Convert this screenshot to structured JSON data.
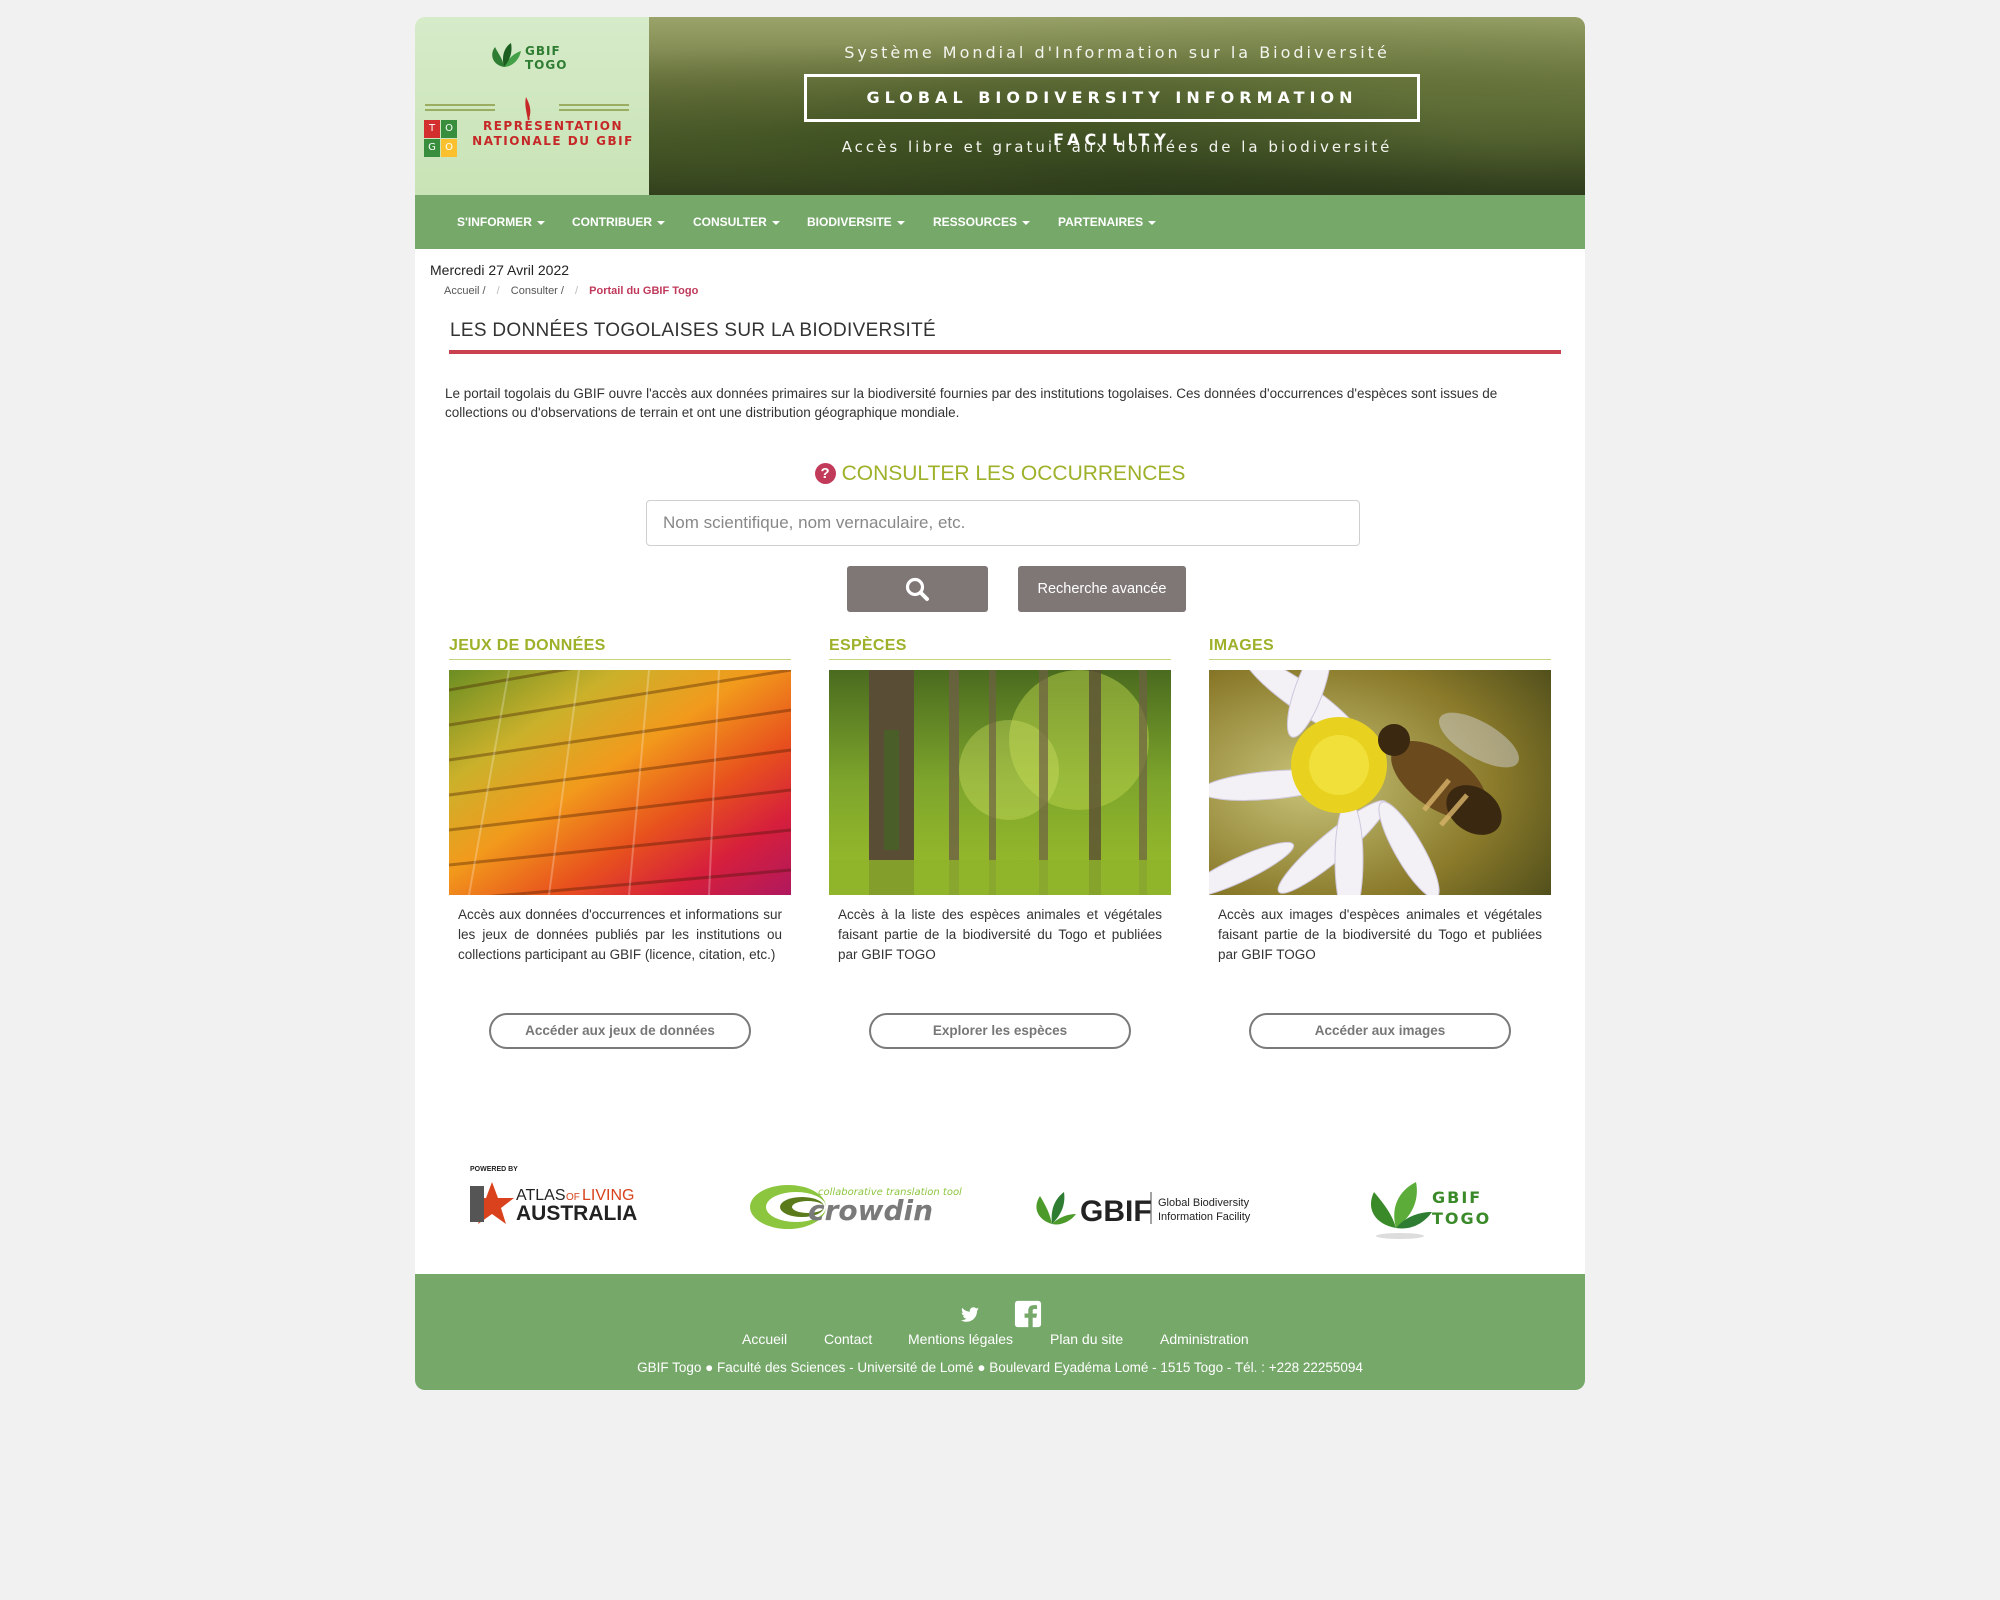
{
  "header": {
    "logo_small_line1": "GBIF",
    "logo_small_line2": "TOGO",
    "rep_line1": "REPRÉSENTATION",
    "rep_line2": "NATIONALE DU GBIF",
    "togo_letters": [
      "T",
      "O",
      "G",
      "O"
    ],
    "banner_top": "Système Mondial d'Information sur la Biodiversité",
    "banner_box": "GLOBAL BIODIVERSITY INFORMATION FACILITY",
    "banner_sub": "Accès libre et gratuit aux données de la biodiversité"
  },
  "nav": {
    "items": [
      "S'INFORMER",
      "CONTRIBUER",
      "CONSULTER",
      "BIODIVERSITE",
      "RESSOURCES",
      "PARTENAIRES"
    ]
  },
  "date": "Mercredi 27 Avril 2022",
  "breadcrumb": {
    "items": [
      "Accueil /",
      "Consulter /",
      "Portail du GBIF Togo"
    ]
  },
  "page_title": "LES DONNÉES TOGOLAISES SUR LA BIODIVERSITÉ",
  "intro": "Le portail togolais du GBIF ouvre l'accès aux données primaires sur la biodiversité fournies par des institutions togolaises. Ces données d'occurrences d'espèces sont issues de collections ou d'observations de terrain et ont une distribution géographique mondiale.",
  "consult": {
    "icon": "?",
    "title": "CONSULTER LES OCCURRENCES",
    "placeholder": "Nom scientifique, nom vernaculaire, etc.",
    "advanced_label": "Recherche avancée"
  },
  "columns": [
    {
      "title": "JEUX DE DONNÉES",
      "text": "Accès aux données d'occurrences et informations sur les jeux de données publiés par les institutions ou collections participant au GBIF (licence, citation, etc.)",
      "button": "Accéder aux jeux de données"
    },
    {
      "title": "ESPÈCES",
      "text": "Accès à la liste des espèces animales et végétales faisant partie de la biodiversité du Togo et publiées par GBIF TOGO",
      "button": "Explorer les espèces"
    },
    {
      "title": "IMAGES",
      "text": "Accès aux images d'espèces animales et végétales faisant partie de la biodiversité du Togo et publiées par GBIF TOGO",
      "button": "Accéder aux images"
    }
  ],
  "partners": {
    "ala_powered": "POWERED BY",
    "ala_name1": "ATLAS",
    "ala_of": "OF",
    "ala_living": "LIVING",
    "ala_name2": "AUSTRALIA",
    "crowdin_tag": "collaborative translation tool",
    "crowdin_name": "crowdin",
    "gbif_name": "GBIF",
    "gbif_sub1": "Global Biodiversity",
    "gbif_sub2": "Information Facility",
    "togo_line1": "GBIF",
    "togo_line2": "TOGO"
  },
  "footer": {
    "links": [
      "Accueil",
      "Contact",
      "Mentions légales",
      "Plan du site",
      "Administration"
    ],
    "address": "GBIF Togo ● Faculté des Sciences - Université de Lomé ● Boulevard Eyadéma Lomé - 1515 Togo - Tél. : +228 22255094"
  }
}
